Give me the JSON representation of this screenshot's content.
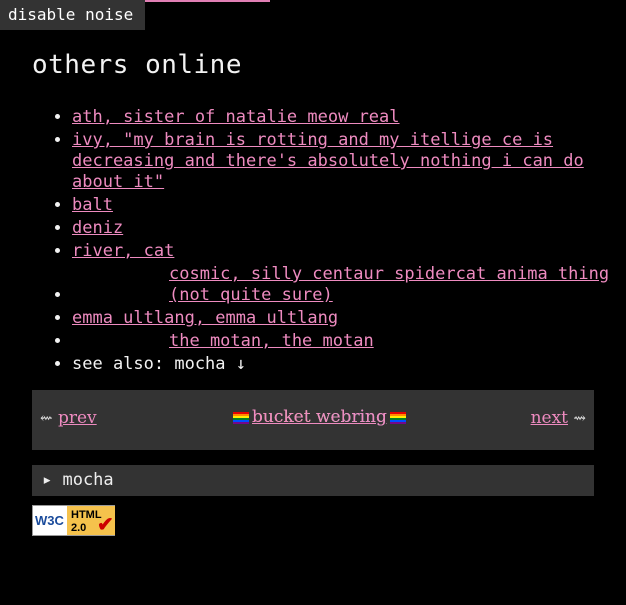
{
  "toggle": {
    "label": "disable noise"
  },
  "page": {
    "title": "others online"
  },
  "people": [
    {
      "text": "ath, sister of natalie meow real"
    },
    {
      "text": "ivy, \"my brain is rotting and my itellige ce is decreasing and there's absolutely nothing i can do about it\""
    },
    {
      "text": "balt"
    },
    {
      "text": "deniz"
    },
    {
      "text": "river, cat"
    },
    {
      "text": "cosmic, silly centaur spidercat anima thing (not quite sure)"
    },
    {
      "text": "emma ultlang, emma ultlang"
    },
    {
      "text": "the motan, the motan"
    }
  ],
  "see_also": {
    "text": "see also: mocha ↓"
  },
  "webring": {
    "prev_arrow": "⇜",
    "prev_label": "prev",
    "title": "bucket webring",
    "next_label": "next",
    "next_arrow": "⇝"
  },
  "details": {
    "summary": "▸ mocha"
  },
  "badge": {
    "text1": "W3C",
    "text2": "HTML",
    "text3": "2.0",
    "icon": "check-icon"
  },
  "colors": {
    "link": "#ee8bc0",
    "panel": "#333333",
    "background": "#000000"
  }
}
